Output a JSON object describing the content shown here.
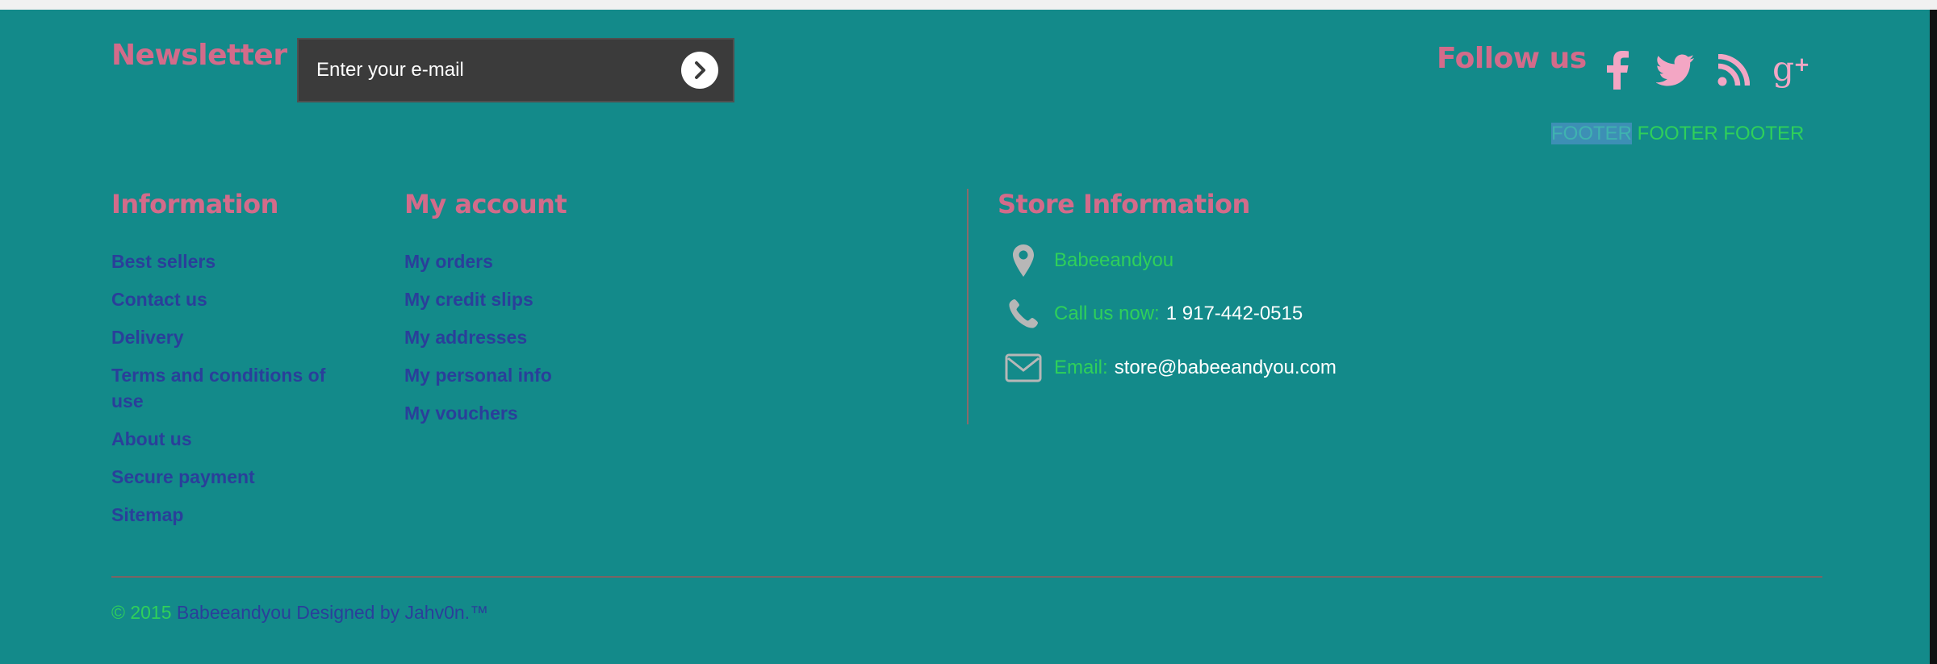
{
  "newsletter": {
    "title": "Newsletter",
    "placeholder": "Enter your e-mail",
    "submit_icon": "chevron-right-icon"
  },
  "follow": {
    "title": "Follow us",
    "icons": [
      "facebook-icon",
      "twitter-icon",
      "rss-icon",
      "google-plus-icon"
    ]
  },
  "footer_text": {
    "highlighted": "FOOTER",
    "rest": "FOOTER FOOTER"
  },
  "information": {
    "title": "Information",
    "items": [
      "Best sellers",
      "Contact us",
      "Delivery",
      "Terms and conditions of use",
      "About us",
      "Secure payment",
      "Sitemap"
    ]
  },
  "account": {
    "title": "My account",
    "items": [
      "My orders",
      "My credit slips",
      "My addresses",
      "My personal info",
      "My vouchers"
    ]
  },
  "store": {
    "title": "Store Information",
    "name": "Babeeandyou",
    "phone_label": "Call us now:",
    "phone": "1 917-442-0515",
    "email_label": "Email:",
    "email": "store@babeeandyou.com"
  },
  "copyright": {
    "year_part": "© 2015",
    "rest": "Babeeandyou Designed by Jahv0n.™"
  },
  "colors": {
    "background": "#138a8a",
    "heading": "#d36b8a",
    "link": "#2a3f9a",
    "green_text": "#2fd05a",
    "icon_pink": "#f3a6c4",
    "icon_gray": "#b7b7b7"
  }
}
